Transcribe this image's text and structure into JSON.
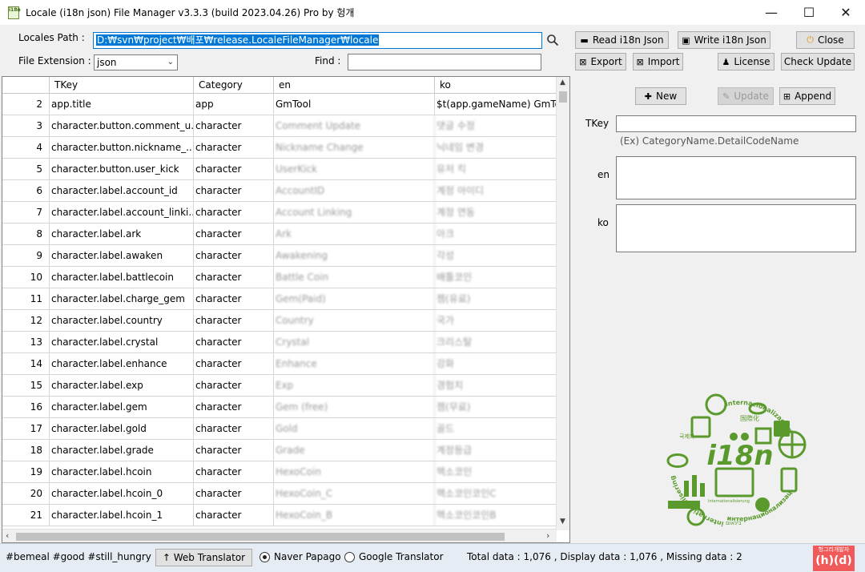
{
  "window": {
    "title": "Locale (i18n json) File Manager v3.3.3 (build 2023.04.26) Pro by 헝개",
    "app_icon_text": "i18n",
    "min_glyph": "—",
    "max_glyph": "☐",
    "close_glyph": "✕"
  },
  "toolbar": {
    "locales_path_label": "Locales Path :",
    "locales_path_value": "D:₩svn₩project₩배포₩release.LocaleFileManager₩locale",
    "file_extension_label": "File Extension :",
    "file_extension_value": "json",
    "find_label": "Find :",
    "find_value": "",
    "read_button": "Read i18n Json",
    "write_button": "Write i18n Json",
    "close_button": "Close",
    "export_button": "Export",
    "import_button": "Import",
    "license_button": "License",
    "check_update_button": "Check Update"
  },
  "grid": {
    "columns": [
      "",
      "TKey",
      "Category",
      "en",
      "ko"
    ],
    "rows": [
      {
        "num": "2",
        "tkey": "app.title",
        "category": "app",
        "en": "GmTool",
        "ko": "$t(app.gameName) GmTool",
        "blurred": false
      },
      {
        "num": "3",
        "tkey": "character.button.comment_u...",
        "category": "character",
        "en": "Comment Update",
        "ko": "댓글 수정",
        "blurred": true
      },
      {
        "num": "4",
        "tkey": "character.button.nickname_...",
        "category": "character",
        "en": "Nickname Change",
        "ko": "닉네임 변경",
        "blurred": true
      },
      {
        "num": "5",
        "tkey": "character.button.user_kick",
        "category": "character",
        "en": "UserKick",
        "ko": "유저 킥",
        "blurred": true
      },
      {
        "num": "6",
        "tkey": "character.label.account_id",
        "category": "character",
        "en": "AccountID",
        "ko": "계정 아이디",
        "blurred": true
      },
      {
        "num": "7",
        "tkey": "character.label.account_linki...",
        "category": "character",
        "en": "Account Linking",
        "ko": "계정 연동",
        "blurred": true
      },
      {
        "num": "8",
        "tkey": "character.label.ark",
        "category": "character",
        "en": "Ark",
        "ko": "아크",
        "blurred": true
      },
      {
        "num": "9",
        "tkey": "character.label.awaken",
        "category": "character",
        "en": "Awakening",
        "ko": "각성",
        "blurred": true
      },
      {
        "num": "10",
        "tkey": "character.label.battlecoin",
        "category": "character",
        "en": "Battle Coin",
        "ko": "배틀코인",
        "blurred": true
      },
      {
        "num": "11",
        "tkey": "character.label.charge_gem",
        "category": "character",
        "en": "Gem(Paid)",
        "ko": "젬(유료)",
        "blurred": true
      },
      {
        "num": "12",
        "tkey": "character.label.country",
        "category": "character",
        "en": "Country",
        "ko": "국가",
        "blurred": true
      },
      {
        "num": "13",
        "tkey": "character.label.crystal",
        "category": "character",
        "en": "Crystal",
        "ko": "크리스탈",
        "blurred": true
      },
      {
        "num": "14",
        "tkey": "character.label.enhance",
        "category": "character",
        "en": "Enhance",
        "ko": "강화",
        "blurred": true
      },
      {
        "num": "15",
        "tkey": "character.label.exp",
        "category": "character",
        "en": "Exp",
        "ko": "경험치",
        "blurred": true
      },
      {
        "num": "16",
        "tkey": "character.label.gem",
        "category": "character",
        "en": "Gem (free)",
        "ko": "젬(무료)",
        "blurred": true
      },
      {
        "num": "17",
        "tkey": "character.label.gold",
        "category": "character",
        "en": "Gold",
        "ko": "골드",
        "blurred": true
      },
      {
        "num": "18",
        "tkey": "character.label.grade",
        "category": "character",
        "en": "Grade",
        "ko": "계정등급",
        "blurred": true
      },
      {
        "num": "19",
        "tkey": "character.label.hcoin",
        "category": "character",
        "en": "HexoCoin",
        "ko": "헥소코인",
        "blurred": true
      },
      {
        "num": "20",
        "tkey": "character.label.hcoin_0",
        "category": "character",
        "en": "HexoCoin_C",
        "ko": "헥소코인코인C",
        "blurred": true
      },
      {
        "num": "21",
        "tkey": "character.label.hcoin_1",
        "category": "character",
        "en": "HexoCoin_B",
        "ko": "헥소코인코인B",
        "blurred": true
      }
    ]
  },
  "panel": {
    "new_button": "New",
    "update_button": "Update",
    "append_button": "Append",
    "tkey_label": "TKey",
    "tkey_value": "",
    "tkey_hint": "(Ex) CategoryName.DetailCodeName",
    "en_label": "en",
    "ko_label": "ko",
    "logo": {
      "center": "i18n",
      "ring_top": "internacionalización",
      "ring_left": "internationalisering",
      "ring_bottom": "интернационализация",
      "word_1": "国際化",
      "word_2": "국제화",
      "word_3": "Internationalisierung",
      "word_4": "בינאום",
      "color": "#5a9a2c"
    }
  },
  "status": {
    "tags": "#bemeal #good #still_hungry",
    "web_translator_button": "↑ Web Translator",
    "naver_label": "Naver Papago",
    "google_label": "Google Translator",
    "selected_translator": "Naver Papago",
    "summary": "Total data : 1,076 , Display data : 1,076 , Missing data : 2",
    "brand_top": "헝그리개발자",
    "brand_bottom": "(h)(d)"
  }
}
